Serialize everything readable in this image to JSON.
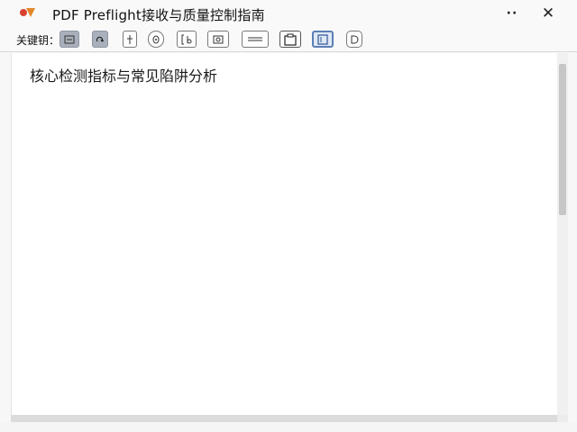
{
  "window": {
    "title": "PDF Preflight接收与质量控制指南"
  },
  "titlebar": {
    "more_label": "··",
    "close_label": "✕"
  },
  "toolbar": {
    "label": "关键钥："
  },
  "content": {
    "heading": "核心检测指标与常见陷阱分析"
  },
  "colors": {
    "active_tool": "#a9b0bb",
    "selected_tool_border": "#5b7fb6",
    "logo_red": "#d8412f",
    "logo_orange": "#e2862a"
  }
}
